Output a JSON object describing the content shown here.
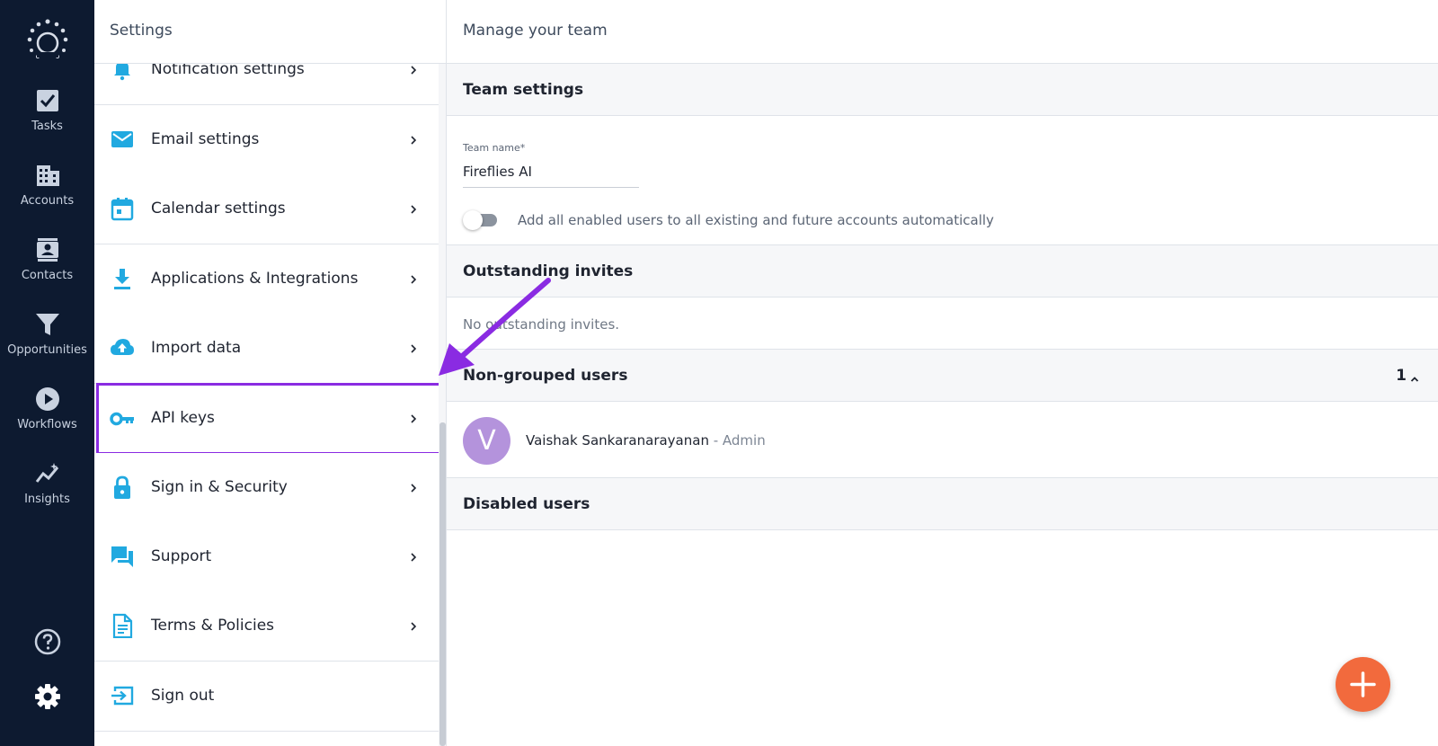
{
  "colors": {
    "rail_bg": "#0d1a30",
    "icon_blue": "#21a9e0",
    "highlight": "#8a2be2",
    "fab": "#f26a3d",
    "avatar": "#b493dc"
  },
  "rail": {
    "logo_icon": "sunburst-logo-icon",
    "items": [
      {
        "label": "Tasks",
        "icon": "checkbox-icon"
      },
      {
        "label": "Accounts",
        "icon": "building-icon"
      },
      {
        "label": "Contacts",
        "icon": "contact-card-icon"
      },
      {
        "label": "Opportunities",
        "icon": "funnel-icon"
      },
      {
        "label": "Workflows",
        "icon": "play-circle-icon"
      },
      {
        "label": "Insights",
        "icon": "sparkline-icon"
      }
    ],
    "help_icon": "help-circle-icon",
    "settings_icon": "gear-icon"
  },
  "settings_menu": {
    "title": "Settings",
    "items": [
      {
        "label": "Notification settings",
        "icon": "bell-icon"
      },
      {
        "label": "Email settings",
        "icon": "envelope-icon"
      },
      {
        "label": "Calendar settings",
        "icon": "calendar-icon"
      },
      {
        "label": "Applications & Integrations",
        "icon": "download-icon"
      },
      {
        "label": "Import data",
        "icon": "cloud-upload-icon"
      },
      {
        "label": "API keys",
        "icon": "key-icon",
        "selected": true
      },
      {
        "label": "Sign in & Security",
        "icon": "lock-icon"
      },
      {
        "label": "Support",
        "icon": "chat-bubbles-icon"
      },
      {
        "label": "Terms & Policies",
        "icon": "document-icon"
      },
      {
        "label": "Sign out",
        "icon": "sign-out-icon"
      }
    ]
  },
  "main": {
    "title": "Manage your team",
    "team_settings": {
      "title": "Team settings",
      "team_name_label": "Team name*",
      "team_name_value": "Fireflies AI",
      "auto_add_toggle": {
        "label": "Add all enabled users to all existing and future accounts automatically",
        "enabled": false
      }
    },
    "outstanding_invites": {
      "title": "Outstanding invites",
      "empty_text": "No outstanding invites."
    },
    "non_grouped_users": {
      "title": "Non-grouped users",
      "count": "1",
      "users": [
        {
          "initial": "V",
          "name": "Vaishak Sankaranarayanan",
          "role": " - Admin"
        }
      ]
    },
    "disabled_users": {
      "title": "Disabled users"
    },
    "fab_icon": "plus-icon"
  }
}
